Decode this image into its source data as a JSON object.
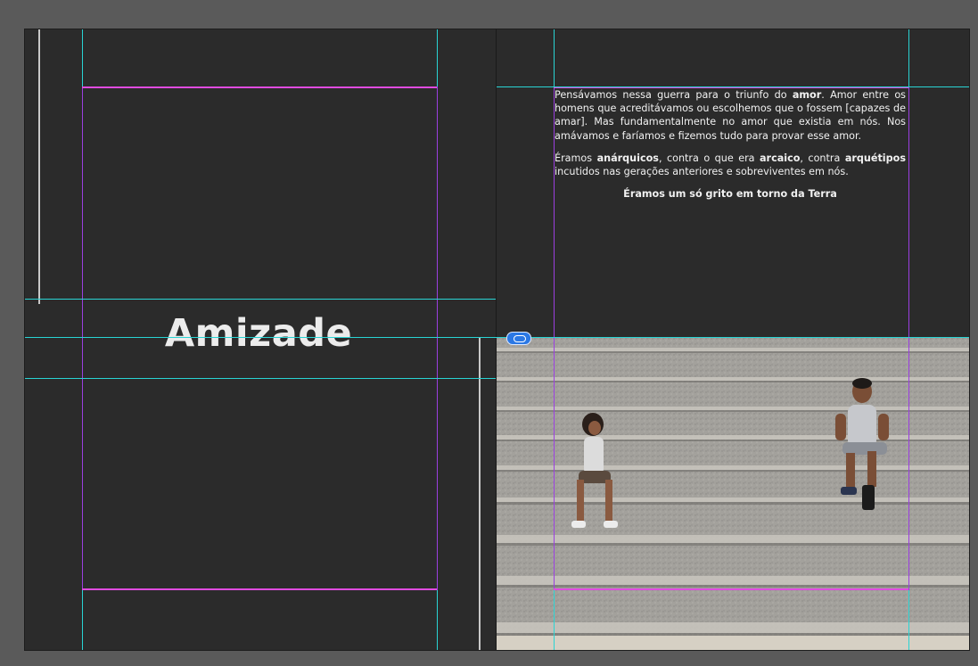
{
  "left_page": {
    "title": "Amizade"
  },
  "right_page": {
    "paragraph1": {
      "t1": "Pensávamos nessa guerra para o triunfo do ",
      "b1": "amor",
      "t2": ". Amor entre os homens que acreditávamos ou escolhemos que o fossem [capazes de amar]. Mas fundamentalmente no amor que existia em nós. Nos amávamos e faríamos e fizemos tudo para provar esse amor."
    },
    "paragraph2": {
      "t1": "Éramos ",
      "b1": "anárquicos",
      "t2": ", contra o que era ",
      "b2": "arcaico",
      "t3": ", contra ",
      "b3": "arquétipos",
      "t4": " incutidos nas gerações anteriores e sobreviventes em nós."
    },
    "closing_line": "Éramos um só grito em torno da Terra"
  },
  "colors": {
    "page_bg": "#2b2b2b",
    "pasteboard": "#5a5a5a",
    "guide_cyan": "#29d4d4",
    "guide_magenta": "#e04be0",
    "guide_violet": "#9b3fe0"
  }
}
